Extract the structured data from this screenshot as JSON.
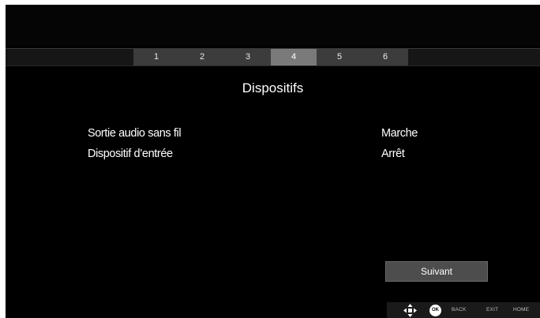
{
  "steps": [
    "1",
    "2",
    "3",
    "4",
    "5",
    "6"
  ],
  "active_step": "4",
  "title": "Dispositifs",
  "settings": [
    {
      "label": "Sortie audio sans fil",
      "value": "Marche"
    },
    {
      "label": "Dispositif d’entrée",
      "value": "Arrêt"
    }
  ],
  "next_button": "Suivant",
  "footer": {
    "ok_label": "OK",
    "back_label": "BACK",
    "exit_label": "EXIT",
    "home_label": "HOME",
    "navigation_icon": "dpad-arrows-icon"
  },
  "colors": {
    "background": "#000000",
    "active_step": "#7a7a7a",
    "inactive_step": "#3c3c3c",
    "button": "#4d4d4d"
  }
}
